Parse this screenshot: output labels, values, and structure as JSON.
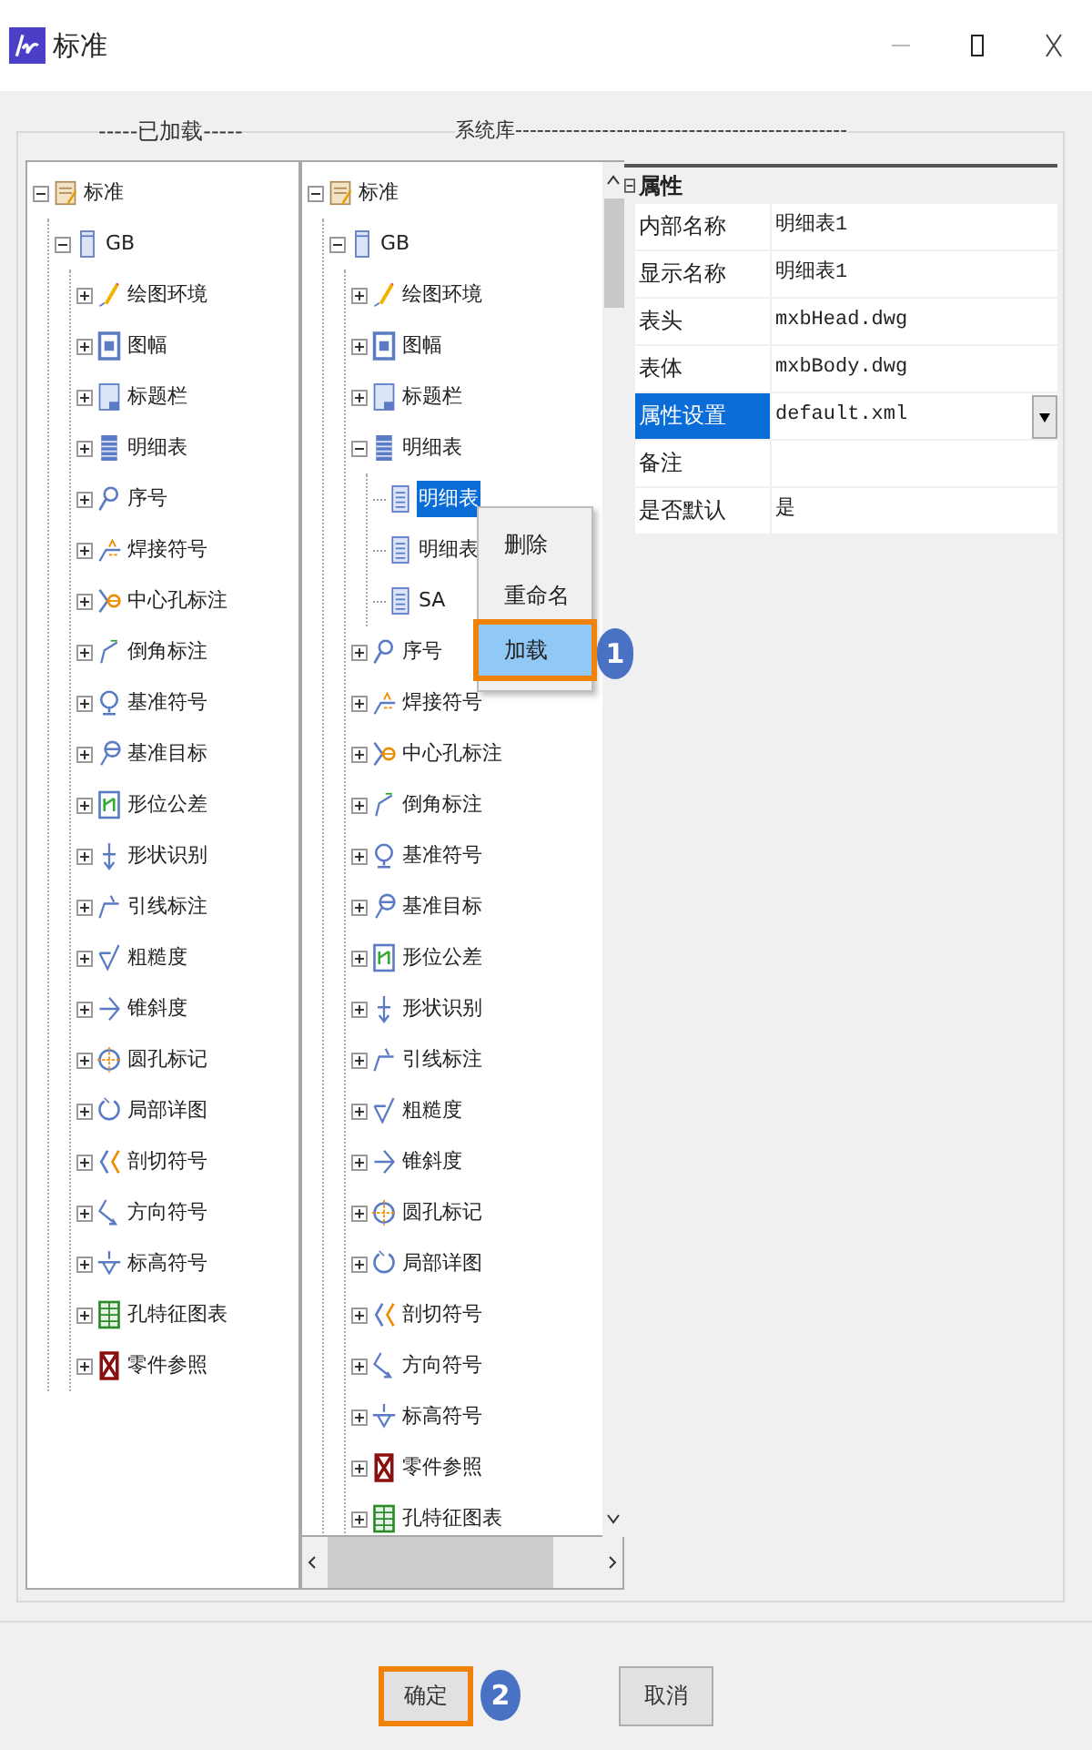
{
  "window": {
    "title": "标准"
  },
  "legends": {
    "loaded": "-----已加载-----",
    "library": "系统库----------------------------------------------"
  },
  "loaded_tree": [
    {
      "label": "标准",
      "kind": "doc",
      "expanded": true,
      "selected": false,
      "children": [
        {
          "label": "GB",
          "kind": "sheet",
          "expanded": true,
          "selected": false,
          "children": [
            {
              "label": "绘图环境",
              "kind": "pencil",
              "expanded": false,
              "selected": false
            },
            {
              "label": "图幅",
              "kind": "frame",
              "expanded": false,
              "selected": false
            },
            {
              "label": "标题栏",
              "kind": "titleblock",
              "expanded": false,
              "selected": false
            },
            {
              "label": "明细表",
              "kind": "table",
              "expanded": false,
              "selected": false
            },
            {
              "label": "序号",
              "kind": "balloon",
              "expanded": false,
              "selected": false
            },
            {
              "label": "焊接符号",
              "kind": "weld",
              "expanded": false,
              "selected": false
            },
            {
              "label": "中心孔标注",
              "kind": "center",
              "expanded": false,
              "selected": false
            },
            {
              "label": "倒角标注",
              "kind": "chamfer",
              "expanded": false,
              "selected": false
            },
            {
              "label": "基准符号",
              "kind": "datum",
              "expanded": false,
              "selected": false
            },
            {
              "label": "基准目标",
              "kind": "target",
              "expanded": false,
              "selected": false
            },
            {
              "label": "形位公差",
              "kind": "tolerance",
              "expanded": false,
              "selected": false
            },
            {
              "label": "形状识别",
              "kind": "shape",
              "expanded": false,
              "selected": false
            },
            {
              "label": "引线标注",
              "kind": "leader",
              "expanded": false,
              "selected": false
            },
            {
              "label": "粗糙度",
              "kind": "rough",
              "expanded": false,
              "selected": false
            },
            {
              "label": "锥斜度",
              "kind": "taper",
              "expanded": false,
              "selected": false
            },
            {
              "label": "圆孔标记",
              "kind": "hole",
              "expanded": false,
              "selected": false
            },
            {
              "label": "局部详图",
              "kind": "detail",
              "expanded": false,
              "selected": false
            },
            {
              "label": "剖切符号",
              "kind": "section",
              "expanded": false,
              "selected": false
            },
            {
              "label": "方向符号",
              "kind": "direction",
              "expanded": false,
              "selected": false
            },
            {
              "label": "标高符号",
              "kind": "elevation",
              "expanded": false,
              "selected": false
            },
            {
              "label": "孔特征图表",
              "kind": "holetable",
              "expanded": false,
              "selected": false
            },
            {
              "label": "零件参照",
              "kind": "partref",
              "expanded": false,
              "selected": false
            }
          ]
        }
      ]
    }
  ],
  "library_tree": [
    {
      "label": "标准",
      "kind": "doc",
      "expanded": true,
      "selected": false,
      "children": [
        {
          "label": "GB",
          "kind": "sheet",
          "expanded": true,
          "selected": false,
          "children": [
            {
              "label": "绘图环境",
              "kind": "pencil",
              "expanded": false,
              "selected": false
            },
            {
              "label": "图幅",
              "kind": "frame",
              "expanded": false,
              "selected": false
            },
            {
              "label": "标题栏",
              "kind": "titleblock",
              "expanded": false,
              "selected": false
            },
            {
              "label": "明细表",
              "kind": "table",
              "expanded": true,
              "selected": false,
              "children": [
                {
                  "label": "明细表",
                  "kind": "list",
                  "selected": true
                },
                {
                  "label": "明细表",
                  "kind": "list",
                  "selected": false
                },
                {
                  "label": "SA",
                  "kind": "list",
                  "selected": false
                }
              ]
            },
            {
              "label": "序号",
              "kind": "balloon",
              "expanded": false,
              "selected": false
            },
            {
              "label": "焊接符号",
              "kind": "weld",
              "expanded": false,
              "selected": false
            },
            {
              "label": "中心孔标注",
              "kind": "center",
              "expanded": false,
              "selected": false
            },
            {
              "label": "倒角标注",
              "kind": "chamfer",
              "expanded": false,
              "selected": false
            },
            {
              "label": "基准符号",
              "kind": "datum",
              "expanded": false,
              "selected": false
            },
            {
              "label": "基准目标",
              "kind": "target",
              "expanded": false,
              "selected": false
            },
            {
              "label": "形位公差",
              "kind": "tolerance",
              "expanded": false,
              "selected": false
            },
            {
              "label": "形状识别",
              "kind": "shape",
              "expanded": false,
              "selected": false
            },
            {
              "label": "引线标注",
              "kind": "leader",
              "expanded": false,
              "selected": false
            },
            {
              "label": "粗糙度",
              "kind": "rough",
              "expanded": false,
              "selected": false
            },
            {
              "label": "锥斜度",
              "kind": "taper",
              "expanded": false,
              "selected": false
            },
            {
              "label": "圆孔标记",
              "kind": "hole",
              "expanded": false,
              "selected": false
            },
            {
              "label": "局部详图",
              "kind": "detail",
              "expanded": false,
              "selected": false
            },
            {
              "label": "剖切符号",
              "kind": "section",
              "expanded": false,
              "selected": false
            },
            {
              "label": "方向符号",
              "kind": "direction",
              "expanded": false,
              "selected": false
            },
            {
              "label": "标高符号",
              "kind": "elevation",
              "expanded": false,
              "selected": false
            },
            {
              "label": "零件参照",
              "kind": "partref",
              "expanded": false,
              "selected": false
            },
            {
              "label": "孔特征图表",
              "kind": "holetable",
              "expanded": false,
              "selected": false
            }
          ]
        }
      ]
    }
  ],
  "context_menu": [
    {
      "label": "删除",
      "selected": false
    },
    {
      "label": "重命名",
      "selected": false
    },
    {
      "label": "加载",
      "selected": true,
      "callout": "1"
    }
  ],
  "properties": {
    "category": "属性",
    "expanded": true,
    "rows": [
      {
        "label": "内部名称",
        "value": "明细表1",
        "kind": "text",
        "selected": false
      },
      {
        "label": "显示名称",
        "value": "明细表1",
        "kind": "text",
        "selected": false
      },
      {
        "label": "表头",
        "value": "mxbHead.dwg",
        "kind": "text",
        "selected": false
      },
      {
        "label": "表体",
        "value": "mxbBody.dwg",
        "kind": "text",
        "selected": false
      },
      {
        "label": "属性设置",
        "value": "default.xml",
        "kind": "dropdown",
        "selected": true
      },
      {
        "label": "备注",
        "kind": "text",
        "selected": false
      },
      {
        "label": "是否默认",
        "value": "是",
        "kind": "text",
        "selected": false
      }
    ]
  },
  "buttons": [
    {
      "label": "确定",
      "callout": "2"
    },
    {
      "label": "取消"
    }
  ]
}
